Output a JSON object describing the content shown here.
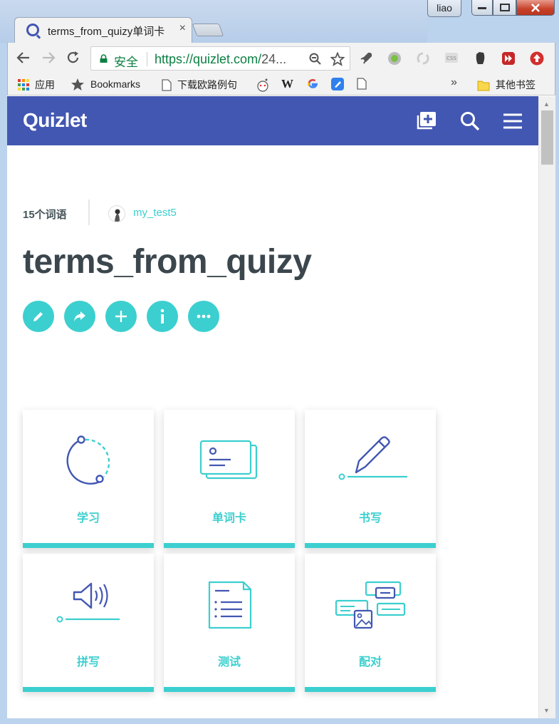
{
  "window": {
    "user": "liao"
  },
  "tab": {
    "title": "terms_from_quizy单词卡",
    "close": "×"
  },
  "omnibox": {
    "secure_label": "安全",
    "url_scheme_host": "https://quizlet.com/",
    "url_rest": "24..."
  },
  "bookmarks": {
    "apps": "应用",
    "bookmarks": "Bookmarks",
    "item3": "下载欧路例句",
    "wiki": "W",
    "more": "»",
    "other": "其他书签"
  },
  "header": {
    "logo": "Quizlet"
  },
  "set": {
    "term_count": "15个词语",
    "username": "my_test5",
    "title": "terms_from_quizy"
  },
  "modes": [
    {
      "label": "学习"
    },
    {
      "label": "单词卡"
    },
    {
      "label": "书写"
    },
    {
      "label": "拼写"
    },
    {
      "label": "测试"
    },
    {
      "label": "配对"
    }
  ],
  "colors": {
    "brand": "#4257b2",
    "accent": "#3ccfcf",
    "title_text": "#3b464d"
  }
}
